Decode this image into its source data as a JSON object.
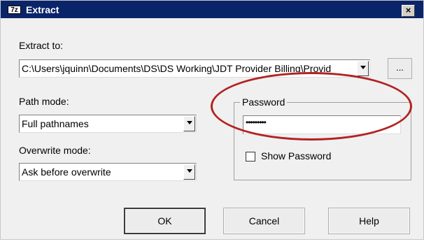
{
  "window": {
    "title": "Extract",
    "icon_text": "7z",
    "close_label": "×"
  },
  "extract_to": {
    "label": "Extract to:",
    "path_value": "C:\\Users\\jquinn\\Documents\\DS\\DS Working\\JDT Provider Billing\\Provid",
    "browse_label": "..."
  },
  "path_mode": {
    "label": "Path mode:",
    "selected": "Full pathnames"
  },
  "overwrite_mode": {
    "label": "Overwrite mode:",
    "selected": "Ask before overwrite"
  },
  "password_group": {
    "legend": "Password",
    "password_value": "•••••••••",
    "show_password_label": "Show Password",
    "show_password_checked": false
  },
  "buttons": {
    "ok": "OK",
    "cancel": "Cancel",
    "help": "Help"
  },
  "colors": {
    "titlebar": "#0a246a",
    "annotation_ellipse": "#b22222"
  }
}
